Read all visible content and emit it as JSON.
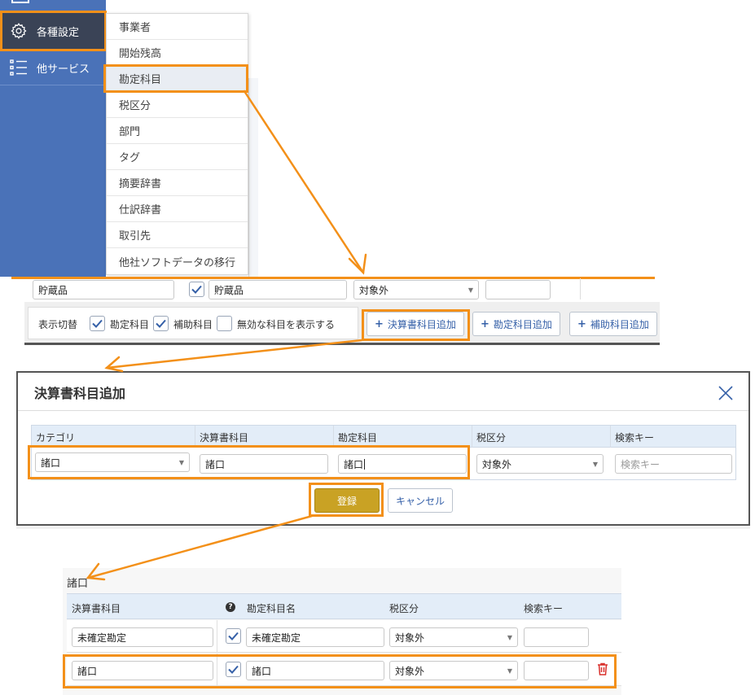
{
  "sidebar": {
    "items": [
      {
        "label": "各種設定",
        "icon": "gear-icon",
        "active": true
      },
      {
        "label": "他サービス",
        "icon": "list-icon",
        "active": false
      }
    ]
  },
  "settings_menu": {
    "items": [
      "事業者",
      "開始残高",
      "勘定科目",
      "税区分",
      "部門",
      "タグ",
      "摘要辞書",
      "仕訳辞書",
      "取引先",
      "他社ソフトデータの移行"
    ],
    "highlighted": "勘定科目"
  },
  "background_row": {
    "col1": "貯蔵品",
    "col2": "貯蔵品",
    "tax": "対象外"
  },
  "toolbar": {
    "toggle_label": "表示切替",
    "check_account": "勘定科目",
    "check_sub": "補助科目",
    "check_invalid": "無効な科目を表示する",
    "btn_add_statement": "決算書科目追加",
    "btn_add_account": "勘定科目追加",
    "btn_add_sub": "補助科目追加"
  },
  "dialog": {
    "title": "決算書科目追加",
    "headers": [
      "カテゴリ",
      "決算書科目",
      "勘定科目",
      "税区分",
      "検索キー"
    ],
    "category_value": "諸口",
    "statement_value": "諸口",
    "account_value": "諸口",
    "tax_value": "対象外",
    "search_placeholder": "検索キー",
    "btn_register": "登録",
    "btn_cancel": "キャンセル"
  },
  "category_table": {
    "title": "諸口",
    "headers": {
      "statement": "決算書科目",
      "account_name": "勘定科目名",
      "tax": "税区分",
      "search_key": "検索キー"
    },
    "rows": [
      {
        "statement": "未確定勘定",
        "checked": true,
        "account": "未確定勘定",
        "tax": "対象外",
        "search": ""
      },
      {
        "statement": "諸口",
        "checked": true,
        "account": "諸口",
        "tax": "対象外",
        "search": ""
      }
    ]
  },
  "colors": {
    "sidebar_bg": "#4a72b8",
    "sidebar_active": "#3a4356",
    "highlight_orange": "#f39019",
    "primary_button": "#c9a224",
    "link_blue": "#3560a8",
    "table_header_bg": "#e3edf8"
  }
}
